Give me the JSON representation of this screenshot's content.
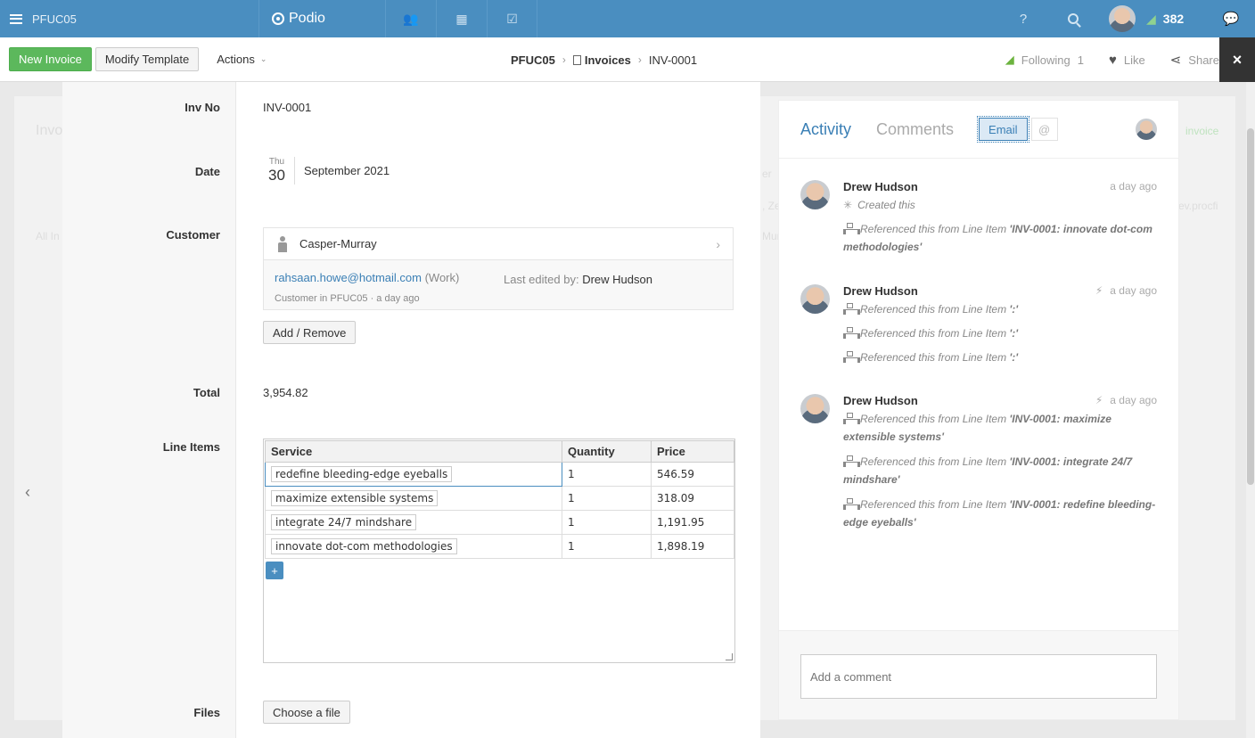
{
  "topnav": {
    "workspace": "PFUC05",
    "brand": "Podio",
    "notifications_count": "382",
    "help": "?"
  },
  "toolbar": {
    "new_invoice": "New Invoice",
    "modify_template": "Modify Template",
    "actions": "Actions",
    "breadcrumb": {
      "workspace": "PFUC05",
      "app": "Invoices",
      "item": "INV-0001"
    },
    "following_label": "Following",
    "following_count": "1",
    "like": "Like",
    "share": "Share",
    "close": "×"
  },
  "fields": {
    "inv_no_label": "Inv No",
    "inv_no_value": "INV-0001",
    "date_label": "Date",
    "date_dow": "Thu",
    "date_day": "30",
    "date_month_year": "September 2021",
    "customer_label": "Customer",
    "customer": {
      "name": "Casper-Murray",
      "email": "rahsaan.howe@hotmail.com",
      "email_type": "(Work)",
      "last_edited_label": "Last edited by:",
      "last_edited_by": "Drew Hudson",
      "meta": "Customer in PFUC05 · a day ago"
    },
    "add_remove": "Add / Remove",
    "total_label": "Total",
    "total_value": "3,954.82",
    "line_items_label": "Line Items",
    "line_items": {
      "headers": [
        "Service",
        "Quantity",
        "Price"
      ],
      "rows": [
        {
          "service": "redefine bleeding-edge eyeballs",
          "quantity": "1",
          "price": "546.59"
        },
        {
          "service": "maximize extensible systems",
          "quantity": "1",
          "price": "318.09"
        },
        {
          "service": "integrate 24/7 mindshare",
          "quantity": "1",
          "price": "1,191.95"
        },
        {
          "service": "innovate dot-com methodologies",
          "quantity": "1",
          "price": "1,898.19"
        }
      ],
      "add": "+"
    },
    "files_label": "Files",
    "choose_file": "Choose a file"
  },
  "activity": {
    "tab_activity": "Activity",
    "tab_comments": "Comments",
    "email_chip": "Email",
    "at_chip": "@",
    "entries": [
      {
        "name": "Drew Hudson",
        "time": "a day ago",
        "created": "Created this",
        "lines": [
          {
            "prefix": "Referenced this from Line Item ",
            "ref": "'INV-0001: innovate dot-com methodologies'"
          }
        ]
      },
      {
        "name": "Drew Hudson",
        "time": "a day ago",
        "lines": [
          {
            "prefix": "Referenced this from Line Item ",
            "ref": "':'"
          },
          {
            "prefix": "Referenced this from Line Item ",
            "ref": "':'"
          },
          {
            "prefix": "Referenced this from Line Item ",
            "ref": "':'"
          }
        ]
      },
      {
        "name": "Drew Hudson",
        "time": "a day ago",
        "lines": [
          {
            "prefix": "Referenced this from Line Item ",
            "ref": "'INV-0001: maximize extensible systems'"
          },
          {
            "prefix": "Referenced this from Line Item ",
            "ref": "'INV-0001: integrate 24/7 mindshare'"
          },
          {
            "prefix": "Referenced this from Line Item ",
            "ref": "'INV-0001: redefine bleeding-edge eyeballs'"
          }
        ]
      }
    ],
    "comment_placeholder": "Add a comment"
  },
  "background": {
    "bg1": "Invo",
    "bg2": "All In",
    "bg3": "invoice",
    "bg4": "er",
    "bg5": ", Ze",
    "bg6": "Mur",
    "bg7": "ev.procfi"
  },
  "colors": {
    "nav": "#4a8ec0",
    "green": "#5cb85c",
    "link": "#3a7fb5"
  }
}
